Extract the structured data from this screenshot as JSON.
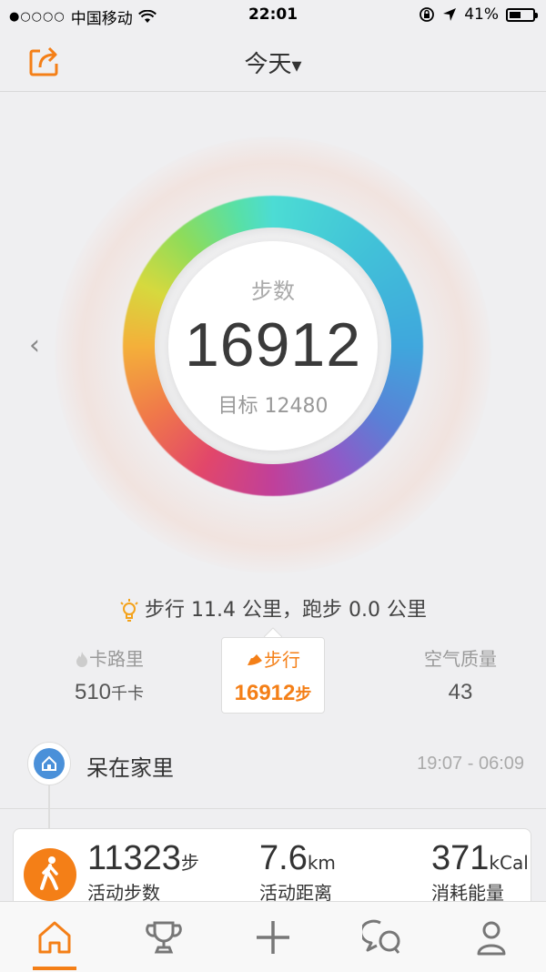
{
  "status": {
    "carrier": "中国移动",
    "signal_dots": "●○○○○",
    "time": "22:01",
    "battery": "41%"
  },
  "nav": {
    "title": "今天",
    "dropdown_glyph": "▾"
  },
  "ring": {
    "label": "步数",
    "value": "16912",
    "goal": "目标 12480",
    "prev_glyph": "‹"
  },
  "summary": "步行 11.4 公里，跑步 0.0 公里",
  "stats": [
    {
      "label": "卡路里",
      "value": "510",
      "unit": "千卡",
      "icon": "flame-icon"
    },
    {
      "label": "步行",
      "value": "16912",
      "unit": "步",
      "icon": "shoe-icon",
      "active": true
    },
    {
      "label": "空气质量",
      "value": "43",
      "unit": "",
      "icon": ""
    }
  ],
  "timeline": {
    "place": "呆在家里",
    "time_range": "19:07 - 06:09"
  },
  "activity": {
    "steps": "11323",
    "steps_unit": "步",
    "steps_caption": "活动步数",
    "distance": "7.6",
    "distance_unit": "km",
    "distance_caption": "活动距离",
    "energy": "371",
    "energy_unit": "kCal",
    "energy_caption": "消耗能量"
  },
  "tabs": [
    "home-icon",
    "trophy-icon",
    "add-icon",
    "chat-icon",
    "profile-icon"
  ],
  "colors": {
    "accent": "#f47f17",
    "home_blue": "#4a90d9"
  }
}
